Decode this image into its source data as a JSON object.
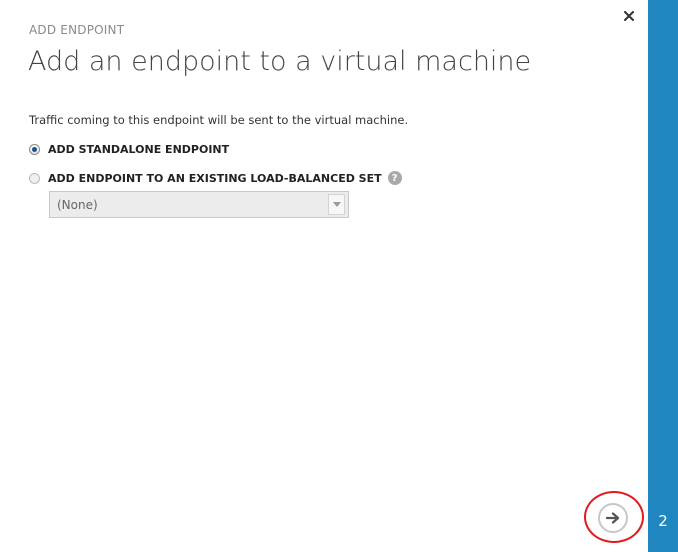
{
  "header": {
    "eyebrow": "ADD ENDPOINT",
    "title": "Add an endpoint to a virtual machine",
    "close_icon": "close-icon"
  },
  "body": {
    "description": "Traffic coming to this endpoint will be sent to the virtual machine.",
    "options": [
      {
        "label": "ADD STANDALONE ENDPOINT",
        "selected": true
      },
      {
        "label": "ADD ENDPOINT TO AN EXISTING LOAD-BALANCED SET",
        "selected": false,
        "help_icon": "?"
      }
    ],
    "load_balanced_select": {
      "value": "(None)",
      "enabled": false
    }
  },
  "footer": {
    "next_icon": "arrow-right-icon",
    "step": "2"
  },
  "colors": {
    "rail": "#1f86bf",
    "highlight": "#e01b1b"
  }
}
